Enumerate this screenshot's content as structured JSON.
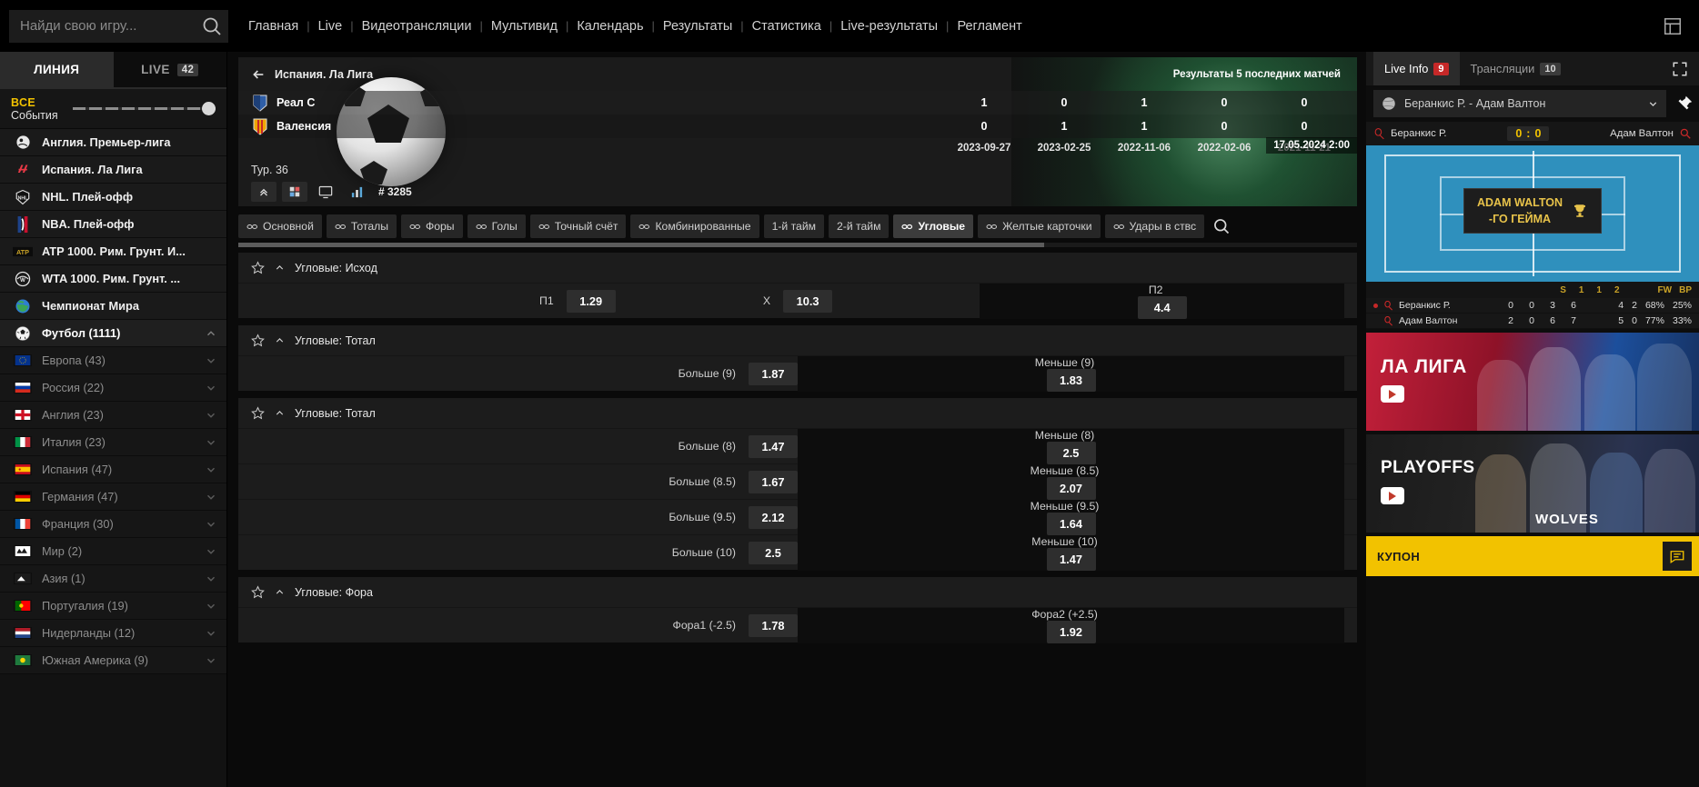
{
  "search": {
    "placeholder": "Найди свою игру..."
  },
  "nav": {
    "items": [
      "Главная",
      "Live",
      "Видеотрансляции",
      "Мультивид",
      "Календарь",
      "Результаты",
      "Статистика",
      "Live-результаты",
      "Регламент"
    ]
  },
  "sidebar": {
    "tabs": [
      {
        "label": "ЛИНИЯ",
        "badge": "",
        "active": true
      },
      {
        "label": "LIVE",
        "badge": "42",
        "active": false
      }
    ],
    "all_events": {
      "line1": "ВСЕ",
      "line2": "События"
    },
    "top_items": [
      {
        "label": "Англия. Премьер-лига",
        "icon": "premier-league-icon"
      },
      {
        "label": "Испания. Ла Лига",
        "icon": "laliga-icon"
      },
      {
        "label": "NHL. Плей-офф",
        "icon": "nhl-icon"
      },
      {
        "label": "NBA. Плей-офф",
        "icon": "nba-icon"
      },
      {
        "label": "ATP 1000. Рим. Грунт. И...",
        "icon": "atp-icon"
      },
      {
        "label": "WTA 1000. Рим. Грунт. ...",
        "icon": "wta-icon"
      },
      {
        "label": "Чемпионат Мира",
        "icon": "globe-icon"
      }
    ],
    "sport": {
      "label": "Футбол (1111)",
      "icon": "football-icon"
    },
    "countries": [
      {
        "label": "Европа (43)",
        "flag": "eu"
      },
      {
        "label": "Россия (22)",
        "flag": "ru"
      },
      {
        "label": "Англия (23)",
        "flag": "en"
      },
      {
        "label": "Италия (23)",
        "flag": "it"
      },
      {
        "label": "Испания (47)",
        "flag": "es"
      },
      {
        "label": "Германия (47)",
        "flag": "de"
      },
      {
        "label": "Франция (30)",
        "flag": "fr"
      },
      {
        "label": "Мир (2)",
        "flag": "world"
      },
      {
        "label": "Азия (1)",
        "flag": "asia"
      },
      {
        "label": "Португалия (19)",
        "flag": "pt"
      },
      {
        "label": "Нидерланды (12)",
        "flag": "nl"
      },
      {
        "label": "Южная Америка (9)",
        "flag": "sa"
      }
    ]
  },
  "match": {
    "league": "Испания. Ла Лига",
    "h2h_title": "Результаты 5 последних матчей",
    "home_team": "Реал С",
    "away_team": "Валенсия",
    "home_results": [
      "1",
      "0",
      "1",
      "0",
      "0"
    ],
    "away_results": [
      "0",
      "1",
      "1",
      "0",
      "0"
    ],
    "dates": [
      "2023-09-27",
      "2023-02-25",
      "2022-11-06",
      "2022-02-06",
      "2021-11-21"
    ],
    "kickoff": "17.05.2024  2:00",
    "tour": "Тур. 36",
    "match_id": "# 3285"
  },
  "market_tabs": [
    {
      "label": "Основной",
      "link": true,
      "active": false
    },
    {
      "label": "Тоталы",
      "link": true,
      "active": false
    },
    {
      "label": "Форы",
      "link": true,
      "active": false
    },
    {
      "label": "Голы",
      "link": true,
      "active": false
    },
    {
      "label": "Точный счёт",
      "link": true,
      "active": false
    },
    {
      "label": "Комбинированные",
      "link": true,
      "active": false
    },
    {
      "label": "1-й тайм",
      "link": false,
      "active": false
    },
    {
      "label": "2-й тайм",
      "link": false,
      "active": false
    },
    {
      "label": "Угловые",
      "link": true,
      "active": true
    },
    {
      "label": "Желтые карточки",
      "link": true,
      "active": false
    },
    {
      "label": "Удары в ствс",
      "link": true,
      "active": false
    }
  ],
  "markets": [
    {
      "title": "Угловые: Исход",
      "rows": [
        [
          {
            "label": "П1",
            "odd": "1.29",
            "pos": "left"
          },
          {
            "label": "X",
            "odd": "10.3",
            "pos": "mid"
          },
          {
            "label": "П2",
            "odd": "4.4",
            "pos": "right"
          }
        ]
      ]
    },
    {
      "title": "Угловые: Тотал",
      "rows": [
        [
          {
            "label": "Больше (9)",
            "odd": "1.87",
            "pos": "left"
          },
          {
            "label": "Меньше (9)",
            "odd": "1.83",
            "pos": "right"
          }
        ]
      ]
    },
    {
      "title": "Угловые: Тотал",
      "rows": [
        [
          {
            "label": "Больше (8)",
            "odd": "1.47",
            "pos": "left"
          },
          {
            "label": "Меньше (8)",
            "odd": "2.5",
            "pos": "right"
          }
        ],
        [
          {
            "label": "Больше (8.5)",
            "odd": "1.67",
            "pos": "left"
          },
          {
            "label": "Меньше (8.5)",
            "odd": "2.07",
            "pos": "right"
          }
        ],
        [
          {
            "label": "Больше (9.5)",
            "odd": "2.12",
            "pos": "left"
          },
          {
            "label": "Меньше (9.5)",
            "odd": "1.64",
            "pos": "right"
          }
        ],
        [
          {
            "label": "Больше (10)",
            "odd": "2.5",
            "pos": "left"
          },
          {
            "label": "Меньше (10)",
            "odd": "1.47",
            "pos": "right"
          }
        ]
      ]
    },
    {
      "title": "Угловые: Фора",
      "rows": [
        [
          {
            "label": "Фора1 (-2.5)",
            "odd": "1.78",
            "pos": "left"
          },
          {
            "label": "Фора2 (+2.5)",
            "odd": "1.92",
            "pos": "right"
          }
        ]
      ]
    }
  ],
  "right_panel": {
    "tabs": [
      {
        "label": "Live Info",
        "badge": "9",
        "badge_color": "#c62828",
        "active": true
      },
      {
        "label": "Трансляции",
        "badge": "10",
        "badge_color": "#3b3b3b",
        "active": false
      }
    ],
    "selected_match": "Беранкис Р. - Адам Валтон",
    "player1": "Беранкис Р.",
    "player2": "Адам Валтон",
    "score": {
      "left": "0",
      "sep": ":",
      "right": "0"
    },
    "court_tip": {
      "line1": "ADAM WALTON",
      "line2": "-ГО ГЕЙМА"
    },
    "stat_headers_left": [
      "S",
      "1",
      "1",
      "2"
    ],
    "stat_headers_right": [
      "FW",
      "BP"
    ],
    "stat_rows": [
      {
        "name": "Беранкис Р.",
        "nums": [
          "0",
          "0",
          "3",
          "6"
        ],
        "right": [
          "4",
          "2",
          "68%",
          "25%"
        ]
      },
      {
        "name": "Адам Валтон",
        "nums": [
          "2",
          "0",
          "6",
          "7"
        ],
        "right": [
          "5",
          "0",
          "77%",
          "33%"
        ]
      }
    ],
    "promos": [
      {
        "title": "ЛА ЛИГА",
        "kind": "laliga"
      },
      {
        "title": "PLAYOFFS",
        "kind": "nba",
        "sub": "WOLVES"
      }
    ],
    "coupon_label": "КУПОН"
  }
}
